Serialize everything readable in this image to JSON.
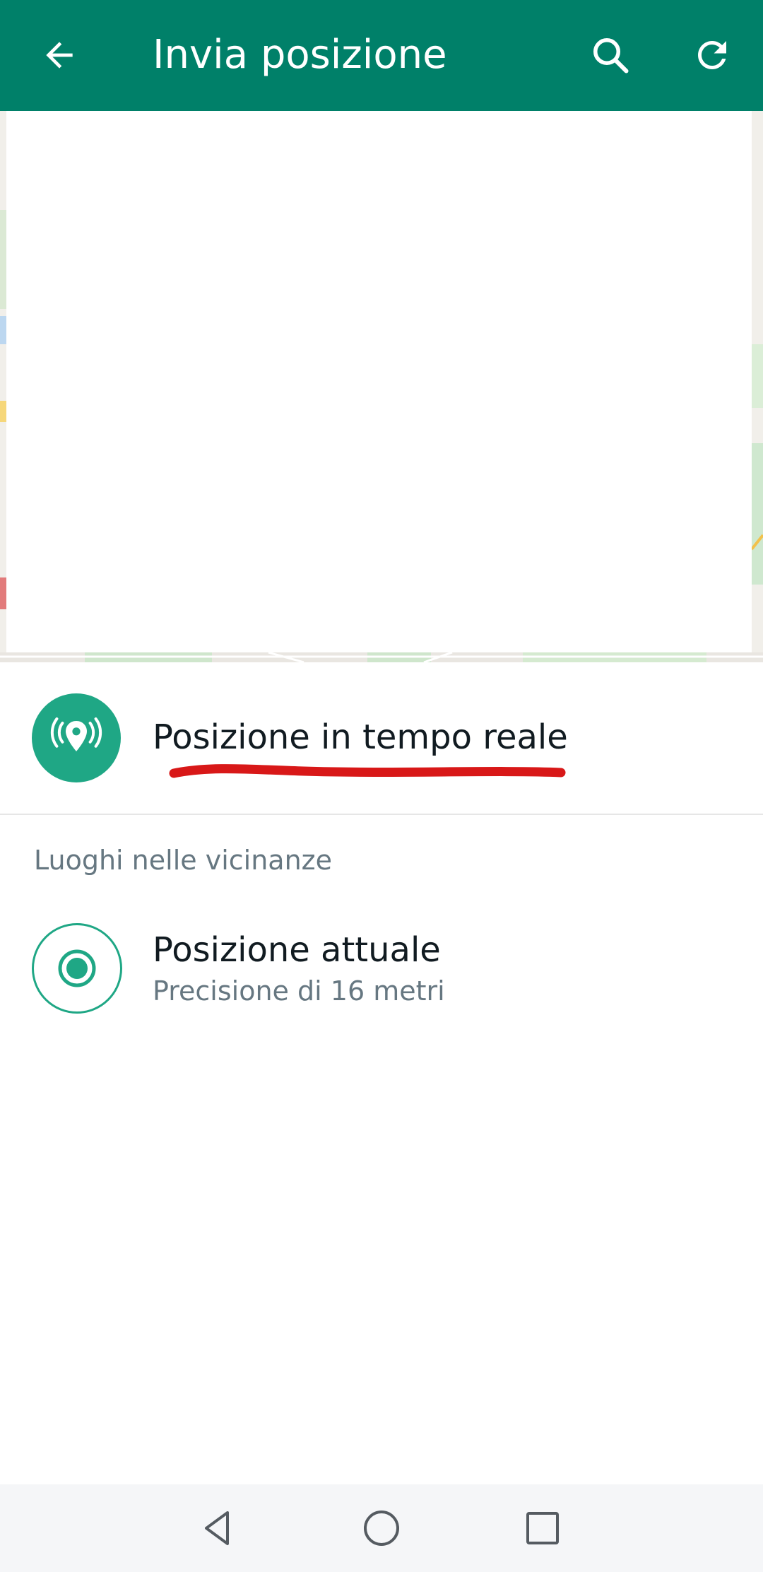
{
  "appbar": {
    "title": "Invia posizione",
    "back_icon": "arrow-back-icon",
    "search_icon": "search-icon",
    "refresh_icon": "refresh-icon",
    "background_color": "#008069"
  },
  "map": {
    "state": "loading"
  },
  "live_location": {
    "label": "Posizione in tempo reale",
    "icon": "live-location-icon",
    "accent_color": "#1fa785",
    "annotation_color": "#d81818"
  },
  "nearby": {
    "section_title": "Luoghi nelle vicinanze",
    "items": [
      {
        "name": "Posizione attuale",
        "subtitle": "Precisione di 16 metri",
        "icon": "current-location-icon"
      }
    ]
  },
  "navigation_bar": {
    "buttons": [
      "back-triangle-icon",
      "home-circle-icon",
      "recents-square-icon"
    ]
  }
}
